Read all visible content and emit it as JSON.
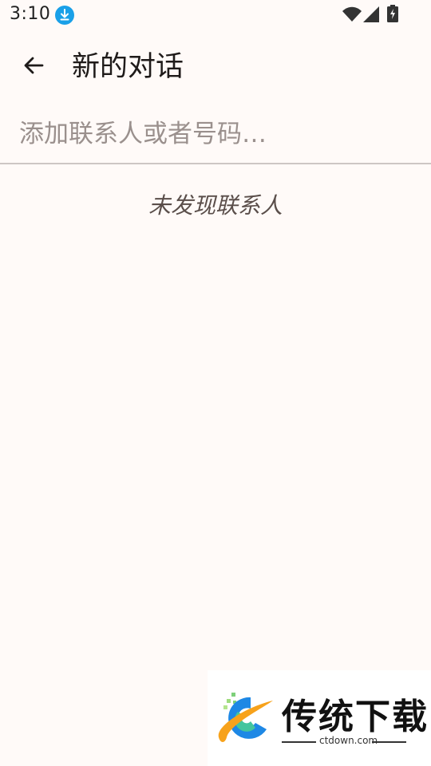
{
  "status_bar": {
    "time": "3:10"
  },
  "app_bar": {
    "title": "新的对话"
  },
  "recipient": {
    "placeholder": "添加联系人或者号码…",
    "value": ""
  },
  "contacts": {
    "empty_message": "未发现联系人"
  },
  "watermark": {
    "brand": "传统下载",
    "url": "ctdown.com"
  },
  "colors": {
    "background": "#fffaf8",
    "download_badge": "#1aa0e8",
    "divider": "#cdc6c4"
  }
}
